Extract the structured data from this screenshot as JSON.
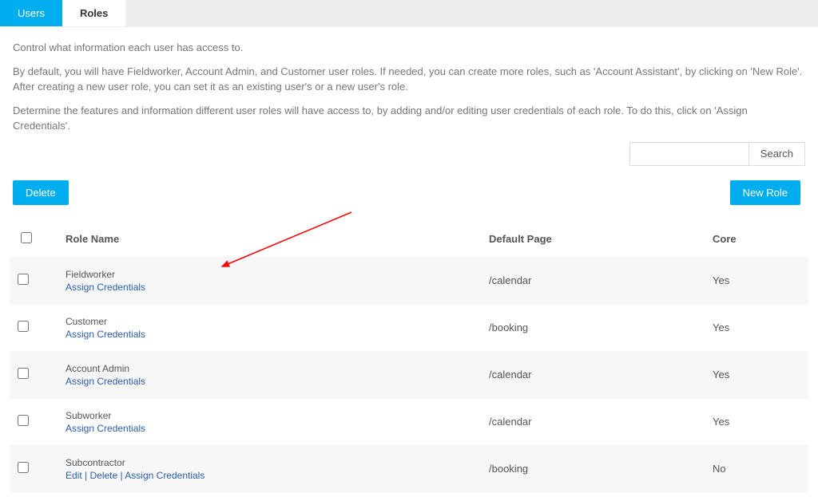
{
  "tabs": {
    "users": "Users",
    "roles": "Roles"
  },
  "description": {
    "line1": "Control what information each user has access to.",
    "line2": "By default, you will have Fieldworker, Account Admin, and Customer user roles. If needed, you can create more roles, such as 'Account Assistant', by clicking on 'New Role'. After creating a new user role, you can set it as an existing user's or a new user's role.",
    "line3": "Determine the features and information different user roles will have access to, by adding and/or editing user credentials of each role. To do this, click on 'Assign Credentials'."
  },
  "buttons": {
    "delete": "Delete",
    "newRole": "New Role",
    "search": "Search"
  },
  "search": {
    "placeholder": ""
  },
  "headers": {
    "roleName": "Role Name",
    "defaultPage": "Default Page",
    "core": "Core"
  },
  "linkLabels": {
    "assign": "Assign Credentials",
    "edit": "Edit",
    "delete": "Delete"
  },
  "rows": [
    {
      "name": "Fieldworker",
      "defaultPage": "/calendar",
      "core": "Yes",
      "editable": false
    },
    {
      "name": "Customer",
      "defaultPage": "/booking",
      "core": "Yes",
      "editable": false
    },
    {
      "name": "Account Admin",
      "defaultPage": "/calendar",
      "core": "Yes",
      "editable": false
    },
    {
      "name": "Subworker",
      "defaultPage": "/calendar",
      "core": "Yes",
      "editable": false
    },
    {
      "name": "Subcontractor",
      "defaultPage": "/booking",
      "core": "No",
      "editable": true
    }
  ]
}
